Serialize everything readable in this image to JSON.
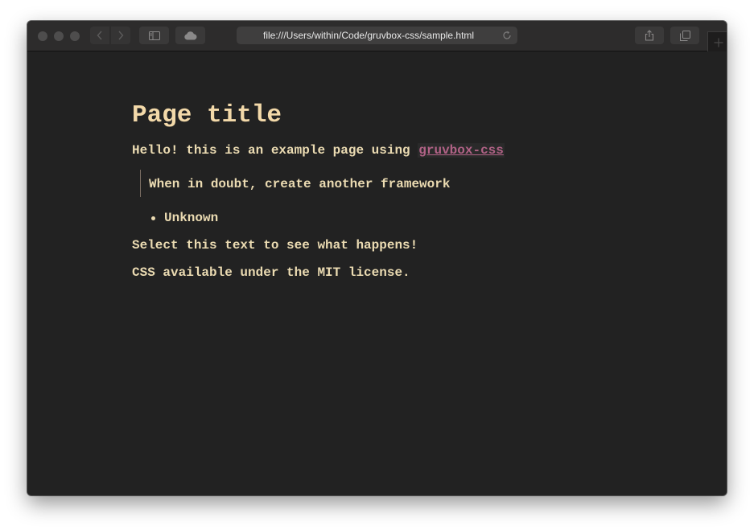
{
  "browser": {
    "url": "file:///Users/within/Code/gruvbox-css/sample.html",
    "icons": {
      "close": "traffic-light",
      "minimize": "traffic-light",
      "zoom": "traffic-light",
      "back": "chevron-left-icon",
      "forward": "chevron-right-icon",
      "sidebar": "sidebar-icon",
      "cloud": "cloud-icon",
      "reload": "reload-icon",
      "share": "share-icon",
      "tabs": "tabs-icon",
      "new_tab": "plus-icon"
    }
  },
  "page": {
    "title": "Page title",
    "intro_text": "Hello! this is an example page using ",
    "intro_link": "gruvbox-css",
    "quote": "When in doubt, create another framework",
    "list_items": [
      "Unknown"
    ],
    "select_text": "Select this text to see what happens!",
    "license_text": "CSS available under the MIT license."
  },
  "colors": {
    "background": "#222222",
    "text": "#ebdbb2",
    "heading": "#f3d9a9",
    "link": "#b16286",
    "toolbar": "#2d2c2c"
  }
}
